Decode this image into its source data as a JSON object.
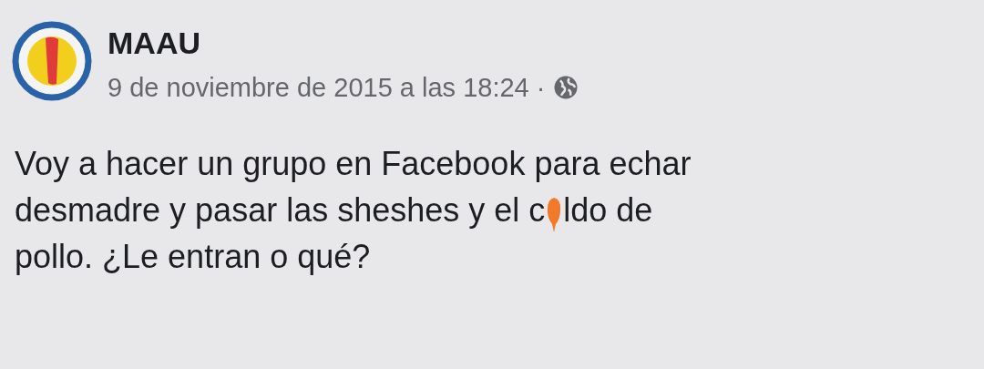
{
  "post": {
    "author": "MAAU",
    "timestamp": "9 de noviembre de 2015 a las 18:24",
    "separator": "·",
    "lines": [
      {
        "text": "Voy a hacer un grupo en Facebook para echar"
      },
      {
        "text": "desmadre y pasar las sheshes y el c",
        "mark_after": true,
        "rest": "ldo de"
      },
      {
        "text": "pollo. ¿Le entran o qué?"
      }
    ]
  }
}
